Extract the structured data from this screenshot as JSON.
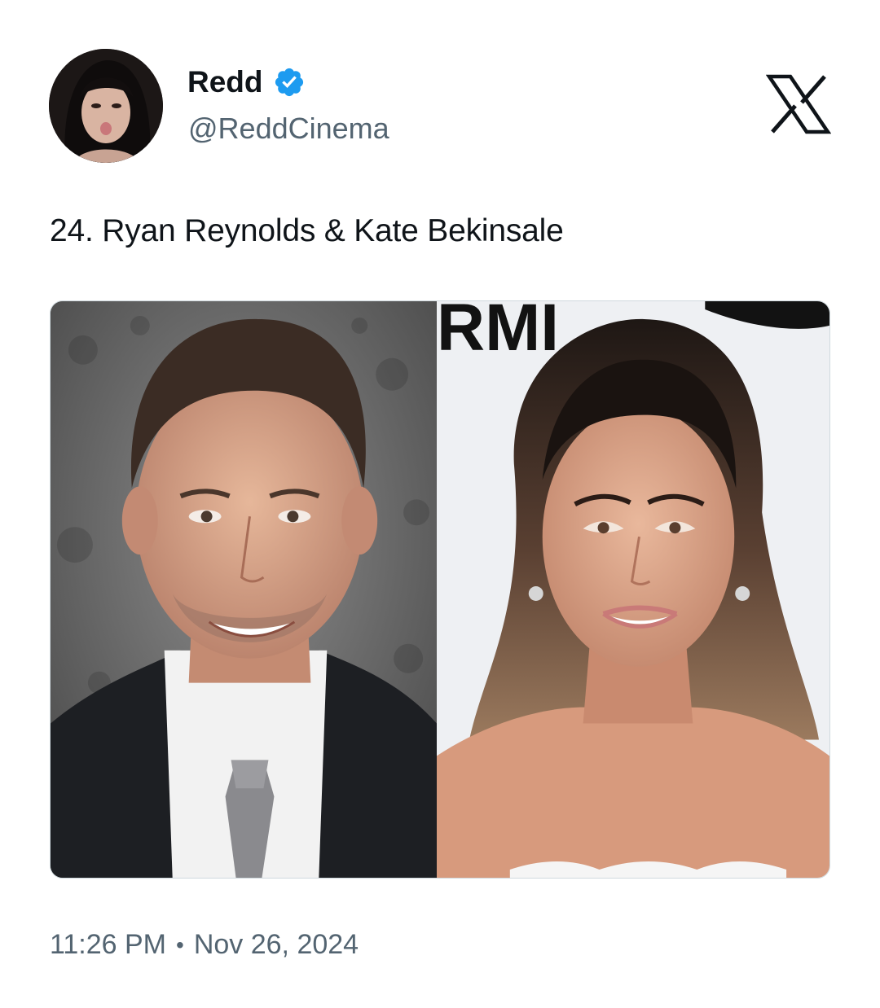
{
  "author": {
    "display_name": "Redd",
    "handle": "@ReddCinema",
    "verified": true,
    "verified_color": "#1d9bf0",
    "avatar_icon": "user-avatar"
  },
  "platform_icon": "x-logo-icon",
  "tweet": {
    "text": "24. Ryan Reynolds & Kate Bekinsale"
  },
  "media": {
    "count": 2,
    "backdrop_text": "RMI"
  },
  "timestamp": {
    "time": "11:26 PM",
    "separator": "•",
    "date": "Nov 26, 2024"
  },
  "colors": {
    "text_primary": "#0f1419",
    "text_secondary": "#536471",
    "border": "#cfd9de"
  }
}
